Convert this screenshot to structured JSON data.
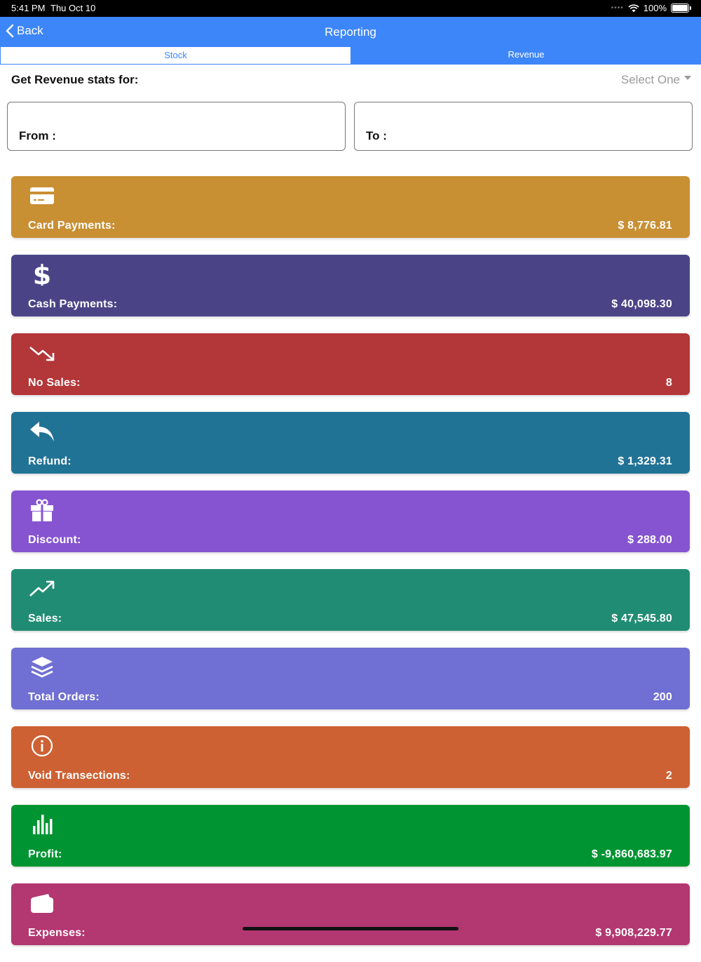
{
  "status_bar": {
    "time": "5:41 PM",
    "date": "Thu Oct 10",
    "battery": "100%"
  },
  "nav": {
    "back_label": "Back",
    "title": "Reporting"
  },
  "tabs": [
    {
      "label": "Stock"
    },
    {
      "label": "Revenue"
    }
  ],
  "filter": {
    "label": "Get Revenue stats for:",
    "select_value": "Select One",
    "from_label": "From :",
    "to_label": "To :"
  },
  "cards": [
    {
      "label": "Card Payments:",
      "value": "$ 8,776.81",
      "color": "#c98f33",
      "icon": "credit-card-icon"
    },
    {
      "label": "Cash Payments:",
      "value": "$ 40,098.30",
      "color": "#4a4487",
      "icon": "dollar-icon"
    },
    {
      "label": "No Sales:",
      "value": "8",
      "color": "#b33638",
      "icon": "trend-down-icon"
    },
    {
      "label": "Refund:",
      "value": "$ 1,329.31",
      "color": "#217396",
      "icon": "reply-icon"
    },
    {
      "label": "Discount:",
      "value": "$ 288.00",
      "color": "#8654d1",
      "icon": "gift-icon"
    },
    {
      "label": "Sales:",
      "value": "$ 47,545.80",
      "color": "#218c74",
      "icon": "trend-up-icon"
    },
    {
      "label": "Total Orders:",
      "value": "200",
      "color": "#706fd3",
      "icon": "layers-icon"
    },
    {
      "label": "Void Transections:",
      "value": "2",
      "color": "#cd6133",
      "icon": "info-icon"
    },
    {
      "label": "Profit:",
      "value": "$ -9,860,683.97",
      "color": "#009432",
      "icon": "bar-chart-icon"
    },
    {
      "label": "Expenses:",
      "value": "$ 9,908,229.77",
      "color": "#b33771",
      "icon": "wallet-icon"
    }
  ]
}
